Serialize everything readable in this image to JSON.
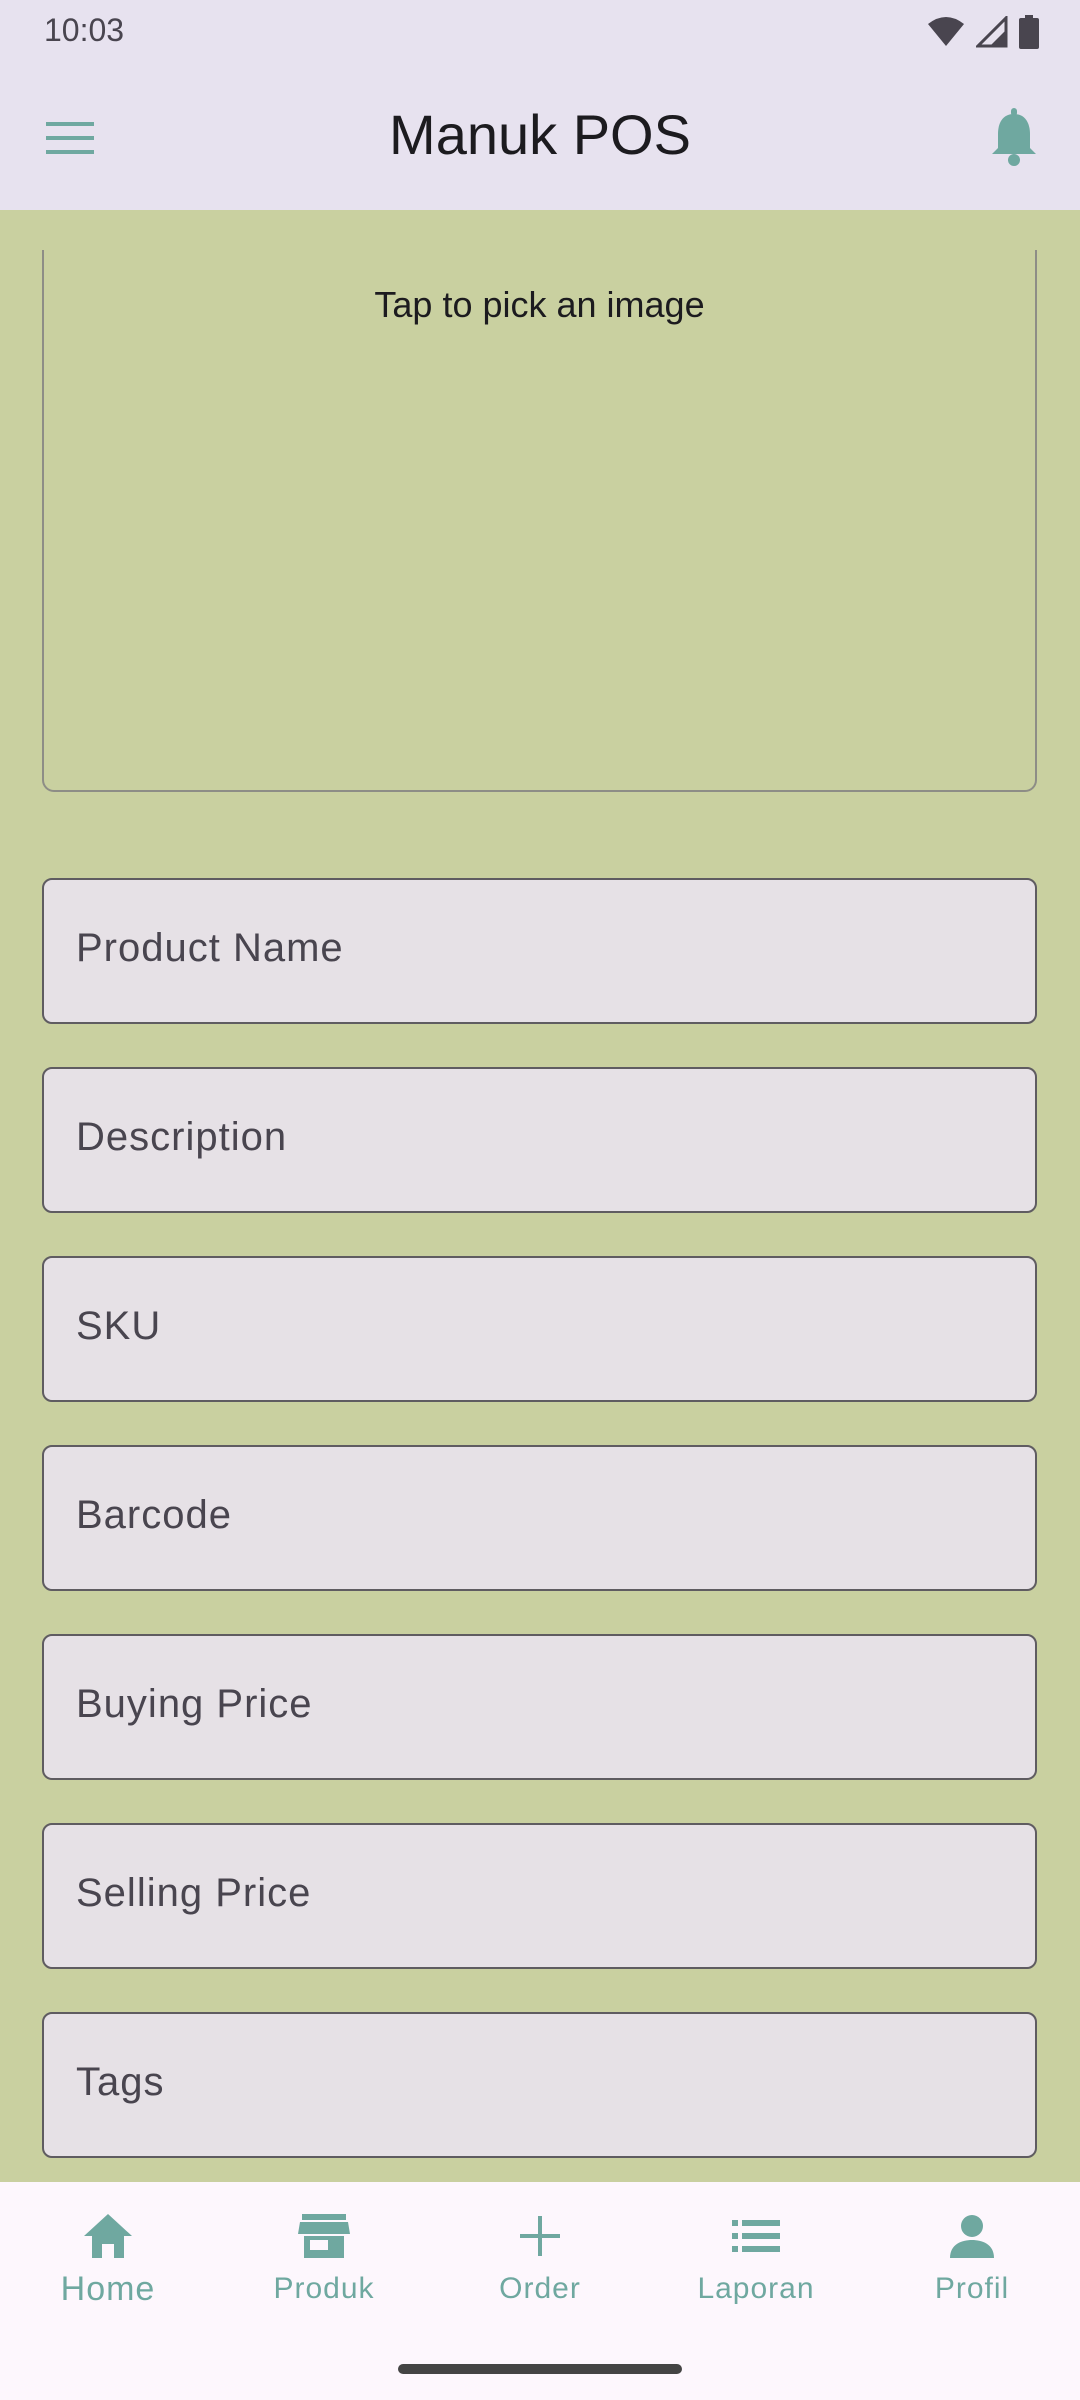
{
  "status_bar": {
    "time": "10:03",
    "icons": [
      "wifi-icon",
      "cell-signal-icon",
      "battery-icon"
    ]
  },
  "app_bar": {
    "title": "Manuk POS",
    "menu_icon": "menu-icon",
    "notification_icon": "bell-icon"
  },
  "image_picker": {
    "label": "Tap to pick an image"
  },
  "form": {
    "fields": [
      {
        "label": "Product Name",
        "value": ""
      },
      {
        "label": "Description",
        "value": ""
      },
      {
        "label": "SKU",
        "value": ""
      },
      {
        "label": "Barcode",
        "value": ""
      },
      {
        "label": "Buying Price",
        "value": ""
      },
      {
        "label": "Selling Price",
        "value": ""
      },
      {
        "label": "Tags",
        "value": ""
      }
    ]
  },
  "bottom_nav": {
    "items": [
      {
        "label": "Home",
        "icon": "home-icon",
        "active": true
      },
      {
        "label": "Produk",
        "icon": "store-icon",
        "active": false
      },
      {
        "label": "Order",
        "icon": "add-icon",
        "active": false
      },
      {
        "label": "Laporan",
        "icon": "list-icon",
        "active": false
      },
      {
        "label": "Profil",
        "icon": "person-icon",
        "active": false
      }
    ]
  },
  "colors": {
    "accent": "#6fa8a0",
    "background": "#c9d0a0",
    "app_bar": "#e7e2ef",
    "field_fill": "#e6e1e6"
  }
}
